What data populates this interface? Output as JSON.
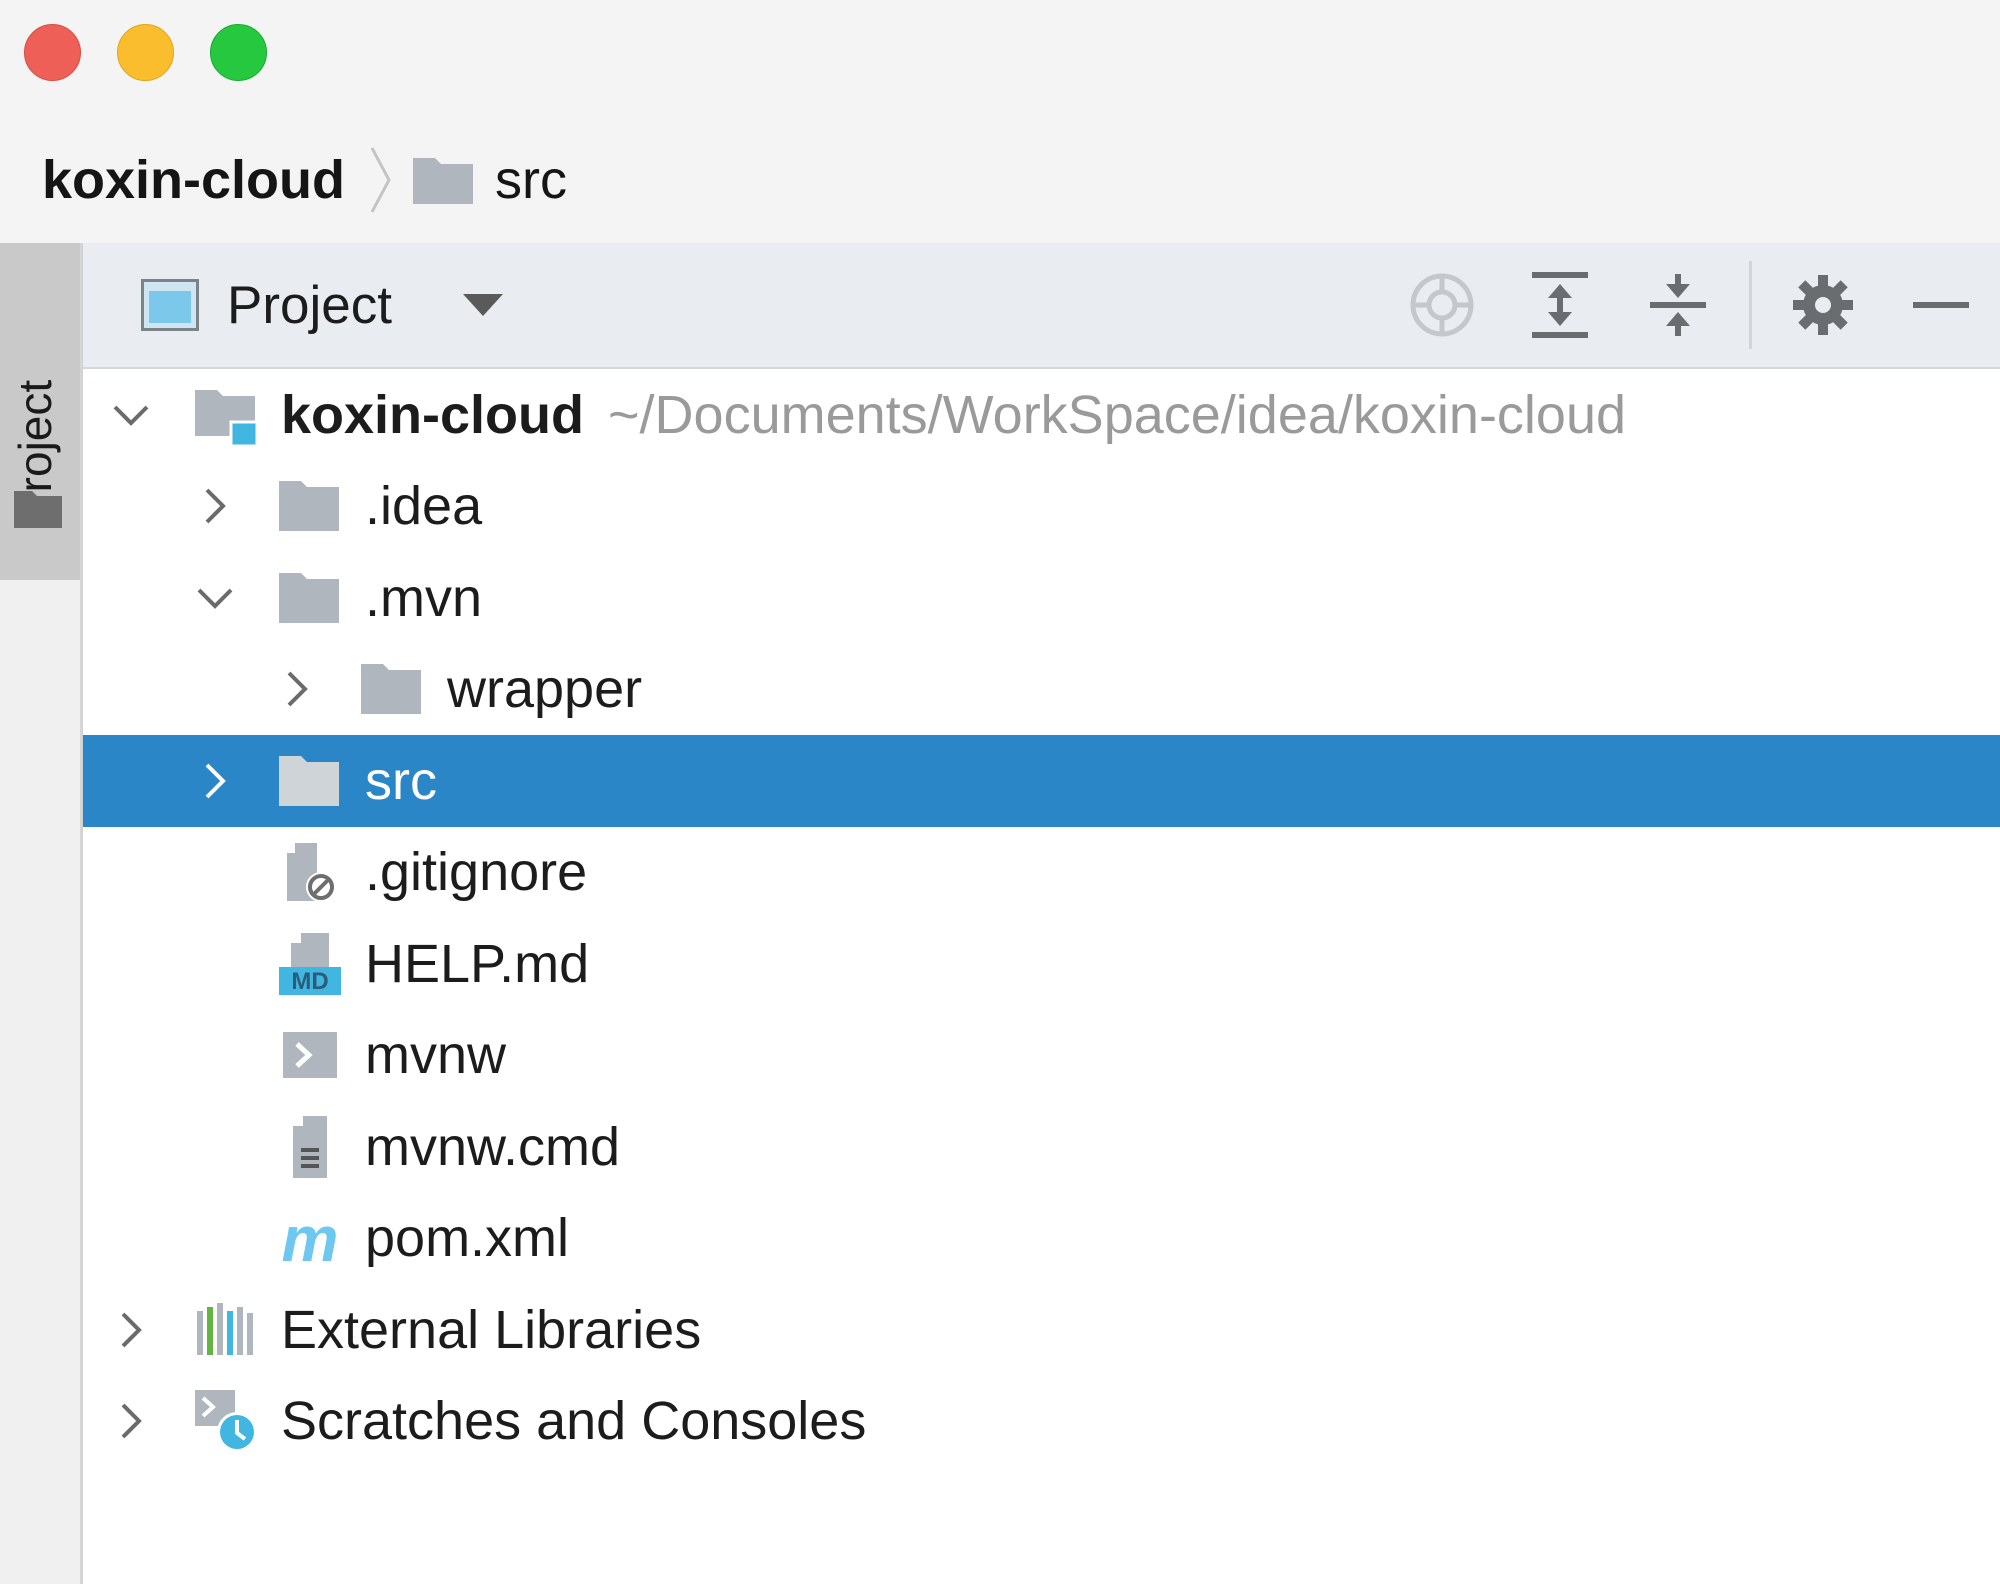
{
  "window": {
    "controls": [
      "close",
      "minimize",
      "maximize"
    ]
  },
  "breadcrumb": {
    "root": "koxin-cloud",
    "current": "src"
  },
  "tool_strip": {
    "label": "Project"
  },
  "panel": {
    "view_label": "Project",
    "tools": [
      "locate-icon",
      "expand-all-icon",
      "collapse-all-icon",
      "gear-icon",
      "minimize-icon"
    ]
  },
  "tree": {
    "root": {
      "name": "koxin-cloud",
      "path": "~/Documents/WorkSpace/idea/koxin-cloud",
      "expanded": true
    },
    "items": [
      {
        "name": ".idea",
        "type": "folder",
        "expanded": false
      },
      {
        "name": ".mvn",
        "type": "folder",
        "expanded": true
      },
      {
        "name": "wrapper",
        "type": "folder",
        "expanded": false
      },
      {
        "name": "src",
        "type": "folder",
        "expanded": false,
        "selected": true
      },
      {
        "name": ".gitignore",
        "type": "ignore-file"
      },
      {
        "name": "HELP.md",
        "type": "markdown-file",
        "badge": "MD"
      },
      {
        "name": "mvnw",
        "type": "shell-file"
      },
      {
        "name": "mvnw.cmd",
        "type": "text-file"
      },
      {
        "name": "pom.xml",
        "type": "maven-file",
        "badge": "m"
      }
    ],
    "external_libraries": "External Libraries",
    "scratches": "Scratches and Consoles"
  },
  "colors": {
    "selection": "#2b86c8",
    "path_text": "#9a9a9a",
    "folder": "#afb6bd",
    "accent_blue": "#40b6e0"
  }
}
